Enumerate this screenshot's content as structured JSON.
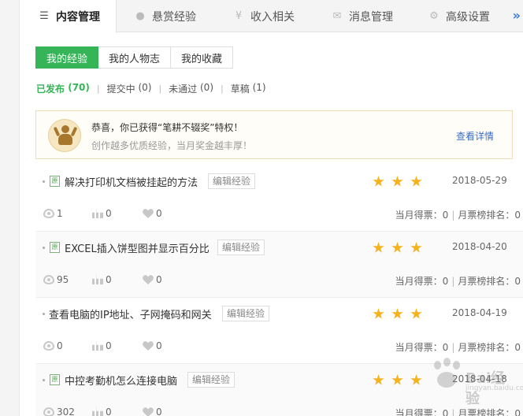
{
  "tabs": [
    {
      "label": "内容管理",
      "icon": "list-icon",
      "active": true
    },
    {
      "label": "悬赏经验",
      "icon": "coin-icon",
      "active": false
    },
    {
      "label": "收入相关",
      "icon": "yen-icon",
      "active": false
    },
    {
      "label": "消息管理",
      "icon": "envelope-icon",
      "active": false
    },
    {
      "label": "高级设置",
      "icon": "gear-icon",
      "active": false
    }
  ],
  "tabs_more": "»",
  "subtabs": [
    {
      "label": "我的经验",
      "active": true
    },
    {
      "label": "我的人物志",
      "active": false
    },
    {
      "label": "我的收藏",
      "active": false
    }
  ],
  "filters": [
    {
      "label": "已发布",
      "count": "(70)",
      "active": true
    },
    {
      "label": "提交中",
      "count": "(0)",
      "active": false
    },
    {
      "label": "未通过",
      "count": "(0)",
      "active": false
    },
    {
      "label": "草稿",
      "count": "(1)",
      "active": false
    }
  ],
  "filter_separator": "|",
  "notice": {
    "title": "恭喜，你已获得“笔耕不辍奖”特权！",
    "subtitle": "创作越多优质经验，当月奖金越丰厚！",
    "link": "查看详情"
  },
  "items": [
    {
      "badge": "原",
      "title": "解决打印机文档被挂起的方法",
      "edit": "编辑经验",
      "stars": 3,
      "date": "2018-05-29",
      "views": "1",
      "votes": "0",
      "likes": "0",
      "ticket_label": "当月得票：0",
      "rank_label": "月票榜排名：0"
    },
    {
      "badge": "原",
      "title": "EXCEL插入饼型图并显示百分比",
      "edit": "编辑经验",
      "stars": 3,
      "date": "2018-04-20",
      "views": "95",
      "votes": "0",
      "likes": "0",
      "ticket_label": "当月得票：0",
      "rank_label": "月票榜排名：0"
    },
    {
      "badge": "",
      "title": "查看电脑的IP地址、子网掩码和网关",
      "edit": "编辑经验",
      "stars": 3,
      "date": "2018-04-19",
      "views": "0",
      "votes": "0",
      "likes": "0",
      "ticket_label": "当月得票：0",
      "rank_label": "月票榜排名：0"
    },
    {
      "badge": "原",
      "title": "中控考勤机怎么连接电脑",
      "edit": "编辑经验",
      "stars": 3,
      "date": "2018-04-18",
      "views": "302",
      "votes": "0",
      "likes": "0",
      "ticket_label": "当月得票：0",
      "rank_label": "月票榜排名：0"
    }
  ],
  "ticket_separator": "|",
  "watermark": {
    "text": "Bai经验",
    "sub": "jingyan.baidu.com"
  }
}
